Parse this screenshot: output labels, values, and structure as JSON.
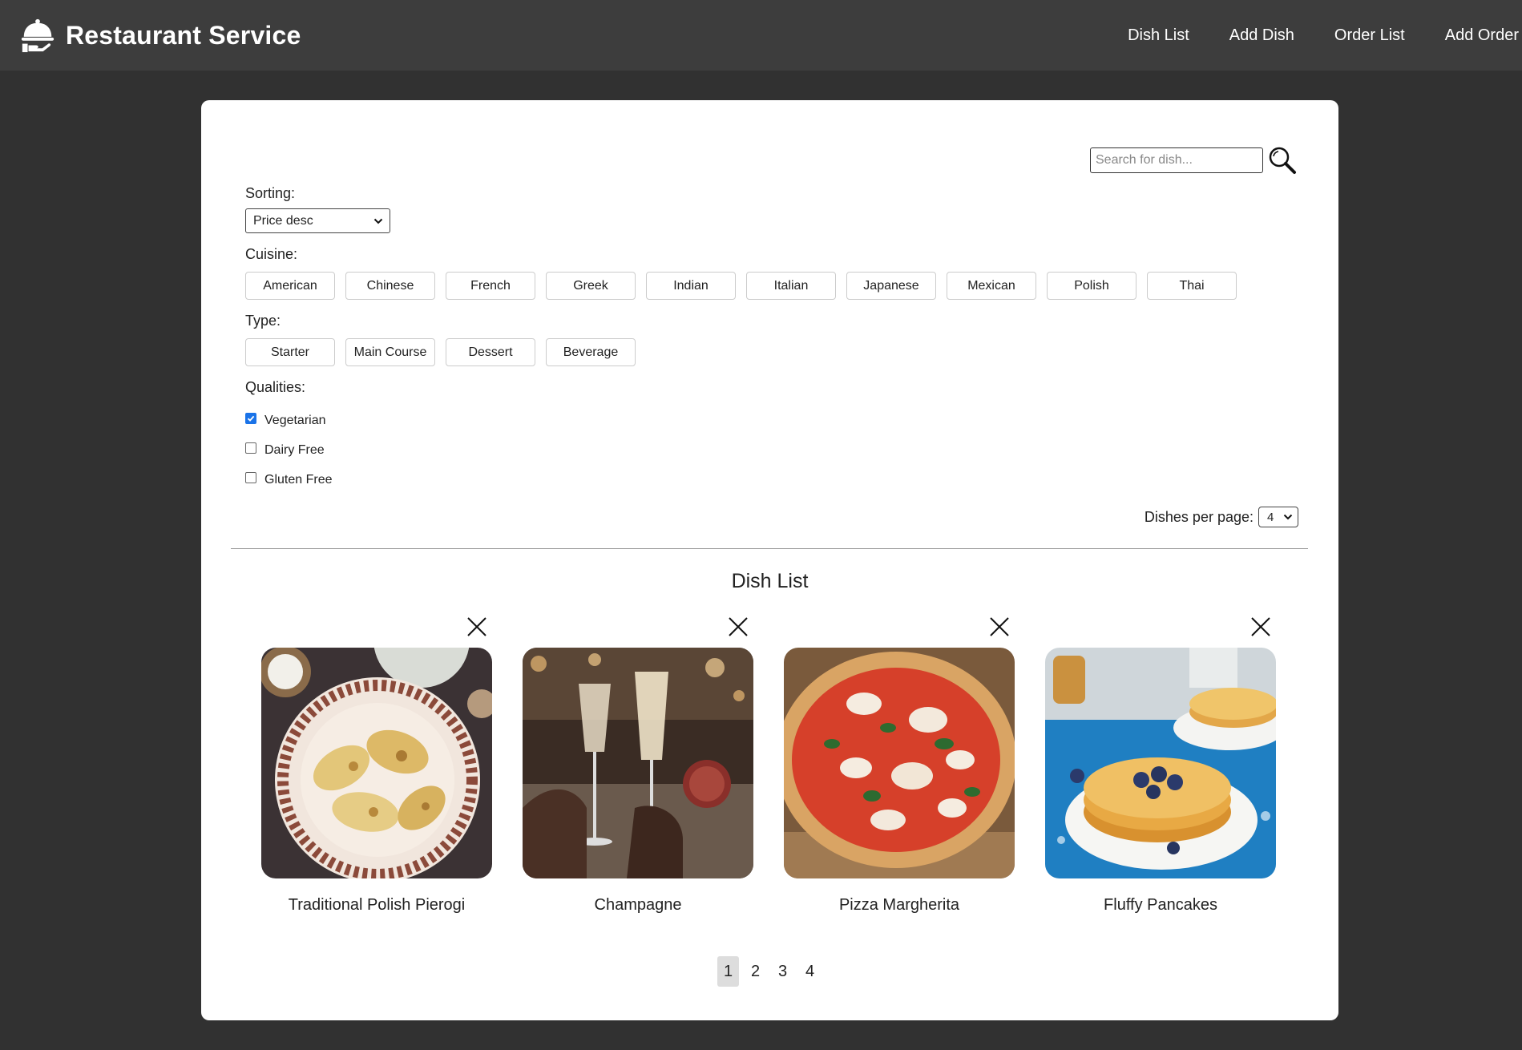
{
  "header": {
    "title": "Restaurant Service",
    "logo_icon": "cloche-serving-icon",
    "nav": [
      "Dish List",
      "Add Dish",
      "Order List",
      "Add Order"
    ]
  },
  "search": {
    "placeholder": "Search for dish...",
    "value": ""
  },
  "filters": {
    "sorting_label": "Sorting:",
    "sorting_value": "Price desc",
    "cuisine_label": "Cuisine:",
    "cuisines": [
      "American",
      "Chinese",
      "French",
      "Greek",
      "Indian",
      "Italian",
      "Japanese",
      "Mexican",
      "Polish",
      "Thai"
    ],
    "type_label": "Type:",
    "types": [
      "Starter",
      "Main Course",
      "Dessert",
      "Beverage"
    ],
    "qualities_label": "Qualities:",
    "qualities": [
      {
        "label": "Vegetarian",
        "checked": true
      },
      {
        "label": "Dairy Free",
        "checked": false
      },
      {
        "label": "Gluten Free",
        "checked": false
      }
    ]
  },
  "per_page": {
    "label": "Dishes per page:",
    "value": "4"
  },
  "dish_list": {
    "title": "Dish List",
    "dishes": [
      {
        "name": "Traditional Polish Pierogi"
      },
      {
        "name": "Champagne"
      },
      {
        "name": "Pizza Margherita"
      },
      {
        "name": "Fluffy Pancakes"
      }
    ]
  },
  "pagination": {
    "pages": [
      "1",
      "2",
      "3",
      "4"
    ],
    "current": "1"
  },
  "colors": {
    "page_bg": "#313131",
    "header_bg": "#3d3d3d",
    "checkbox": "#1a73e8"
  }
}
